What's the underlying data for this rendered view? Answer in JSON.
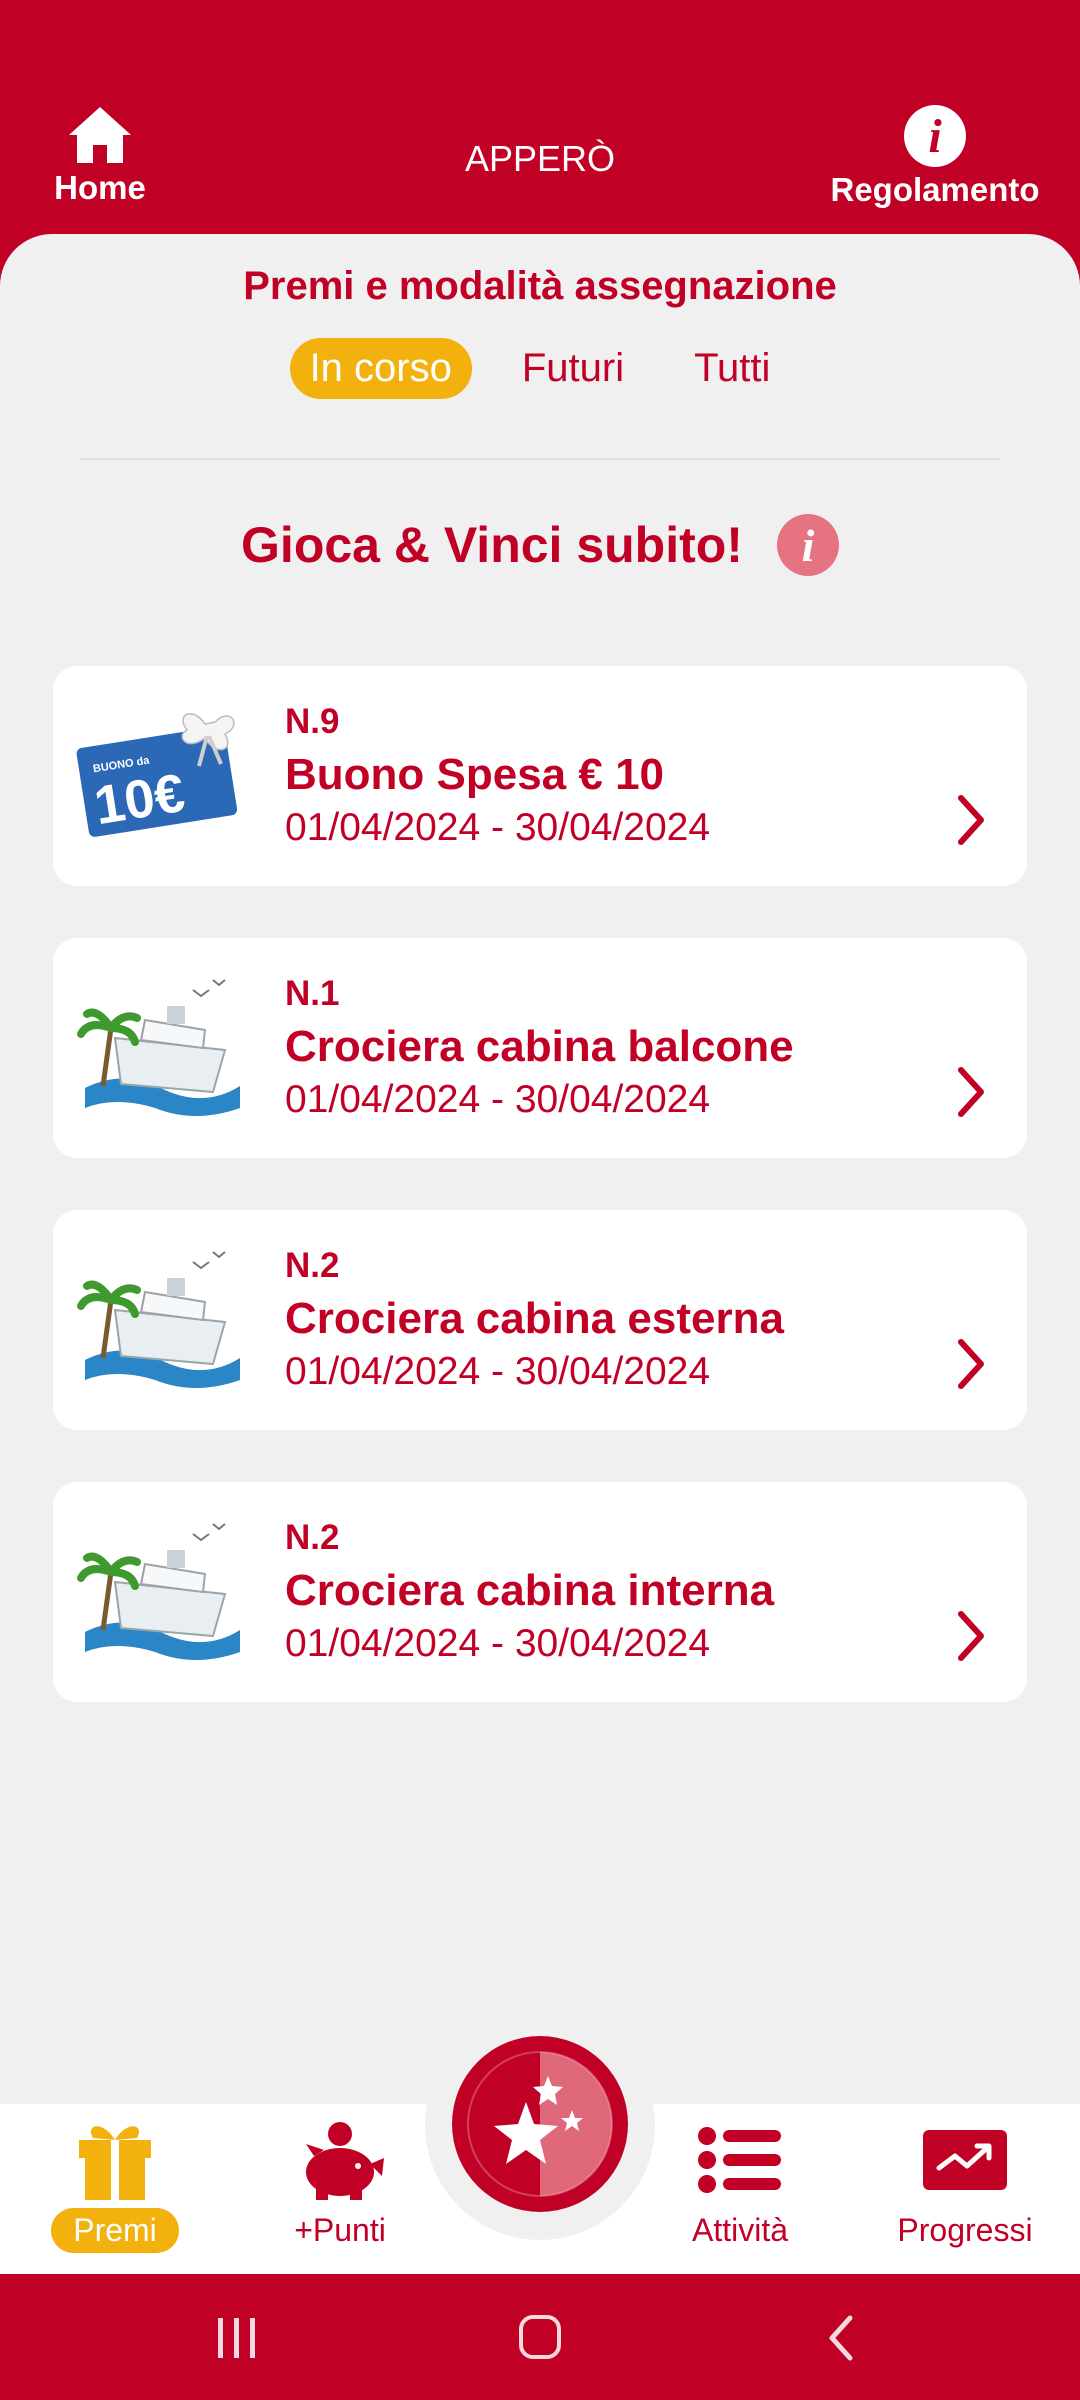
{
  "header": {
    "home_label": "Home",
    "app_title": "APPERÒ",
    "rules_label": "Regolamento"
  },
  "sheet": {
    "title": "Premi e modalità assegnazione",
    "tabs": [
      {
        "label": "In corso",
        "active": true
      },
      {
        "label": "Futuri",
        "active": false
      },
      {
        "label": "Tutti",
        "active": false
      }
    ],
    "section_title": "Gioca & Vinci subito!",
    "prizes": [
      {
        "number": "N.9",
        "name": "Buono Spesa € 10",
        "dates": "01/04/2024 - 30/04/2024",
        "thumb": "voucher-10-euro",
        "voucher_text": "BUONO da",
        "voucher_value": "10€"
      },
      {
        "number": "N.1",
        "name": "Crociera cabina balcone",
        "dates": "01/04/2024 - 30/04/2024",
        "thumb": "cruise-ship"
      },
      {
        "number": "N.2",
        "name": "Crociera cabina esterna",
        "dates": "01/04/2024 - 30/04/2024",
        "thumb": "cruise-ship"
      },
      {
        "number": "N.2",
        "name": "Crociera cabina interna",
        "dates": "01/04/2024 - 30/04/2024",
        "thumb": "cruise-ship"
      }
    ]
  },
  "bottom_nav": {
    "items": [
      {
        "label": "Premi",
        "icon": "gift-icon",
        "active": true
      },
      {
        "label": "+Punti",
        "icon": "piggy-bank-icon",
        "active": false
      },
      {
        "label": "Attività",
        "icon": "list-icon",
        "active": false
      },
      {
        "label": "Progressi",
        "icon": "trend-chart-icon",
        "active": false
      }
    ],
    "center_icon": "stars-icon"
  },
  "colors": {
    "brand_red": "#c10026",
    "accent_yellow": "#f2b10d",
    "background": "#f1f0f1",
    "info_pink": "#e57382"
  }
}
